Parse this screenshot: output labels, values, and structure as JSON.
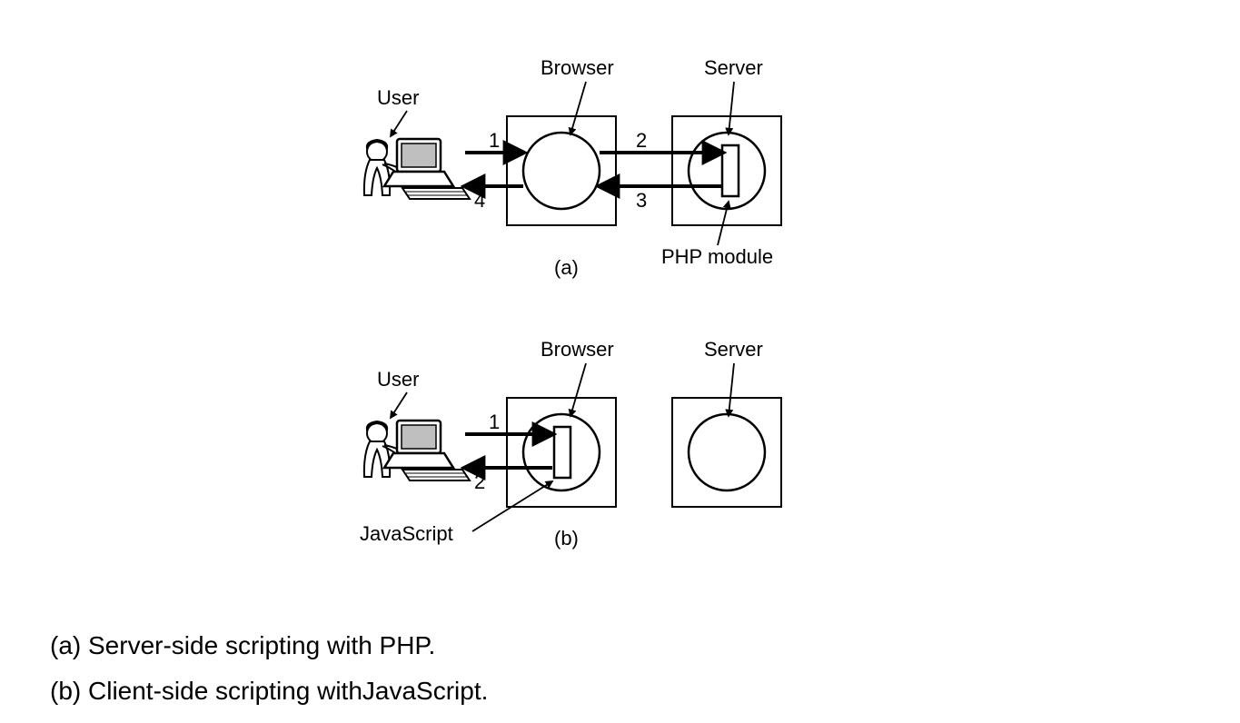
{
  "diagram_a": {
    "user_label": "User",
    "browser_label": "Browser",
    "server_label": "Server",
    "php_label": "PHP module",
    "sub_label": "(a)",
    "arrows": {
      "n1": "1",
      "n2": "2",
      "n3": "3",
      "n4": "4"
    }
  },
  "diagram_b": {
    "user_label": "User",
    "browser_label": "Browser",
    "server_label": "Server",
    "js_label": "JavaScript",
    "sub_label": "(b)",
    "arrows": {
      "n1": "1",
      "n2": "2"
    }
  },
  "captions": {
    "a": "(a) Server-side scripting with PHP.",
    "b": "(b) Client-side scripting withJavaScript."
  }
}
